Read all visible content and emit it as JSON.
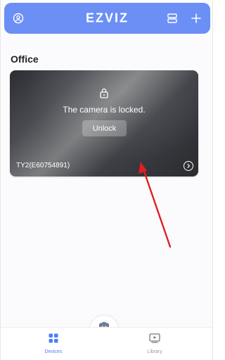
{
  "header": {
    "brand": "EZVIZ",
    "profile_icon": "user-circle-icon",
    "layout_icon": "layout-icon",
    "add_icon": "plus-icon"
  },
  "section": {
    "title": "Office"
  },
  "camera": {
    "lock_icon": "lock-icon",
    "lock_message": "The camera is locked.",
    "unlock_label": "Unlock",
    "name": "TY2(E60754891)",
    "detail_icon": "chevron-right-icon"
  },
  "tabbar": {
    "devices": {
      "label": "Devices",
      "icon": "grid-icon"
    },
    "library": {
      "label": "Library",
      "icon": "library-icon"
    },
    "fab_icon": "shield-x-icon"
  },
  "colors": {
    "header_bg": "#6b8ff5",
    "accent": "#4f7ef7",
    "annotation": "#e02020"
  }
}
